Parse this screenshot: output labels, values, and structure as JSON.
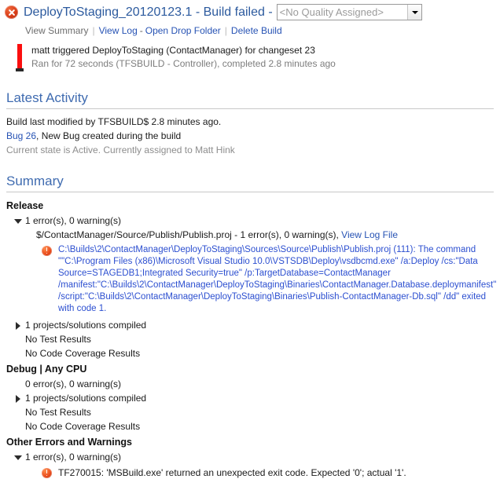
{
  "header": {
    "status_icon": "build-failed-icon",
    "title": "DeployToStaging_20120123.1 - Build failed -",
    "quality": {
      "value": "<No Quality Assigned>",
      "arrow_icon": "chevron-down-icon"
    }
  },
  "commands": {
    "view_summary": "View Summary",
    "view_log": "View Log",
    "open_drop_folder": "Open Drop Folder",
    "delete_build": "Delete Build",
    "dash": "-"
  },
  "trigger": {
    "line1": "matt triggered DeployToStaging (ContactManager) for changeset 23",
    "line2": "Ran for 72 seconds (TFSBUILD - Controller), completed 2.8 minutes ago"
  },
  "latest_activity": {
    "heading": "Latest Activity",
    "modified": "Build last modified by TFSBUILD$ 2.8 minutes ago.",
    "bug_link": "Bug 26",
    "bug_rest": ", New Bug created during the build",
    "bug_state": "Current state is Active. Currently assigned to Matt Hink"
  },
  "summary": {
    "heading": "Summary",
    "configs": [
      {
        "name": "Release",
        "counts": "1 error(s), 0 warning(s)",
        "counts_expanded": true,
        "file_line_prefix": "$/ContactManager/Source/Publish/Publish.proj - 1 error(s), 0 warning(s), ",
        "file_link": "View Log File",
        "error": "C:\\Builds\\2\\ContactManager\\DeployToStaging\\Sources\\Source\\Publish\\Publish.proj (111): The command \"\"C:\\Program Files (x86)\\Microsoft Visual Studio 10.0\\VSTSDB\\Deploy\\vsdbcmd.exe\" /a:Deploy /cs:\"Data Source=STAGEDB1;Integrated Security=true\" /p:TargetDatabase=ContactManager /manifest:\"C:\\Builds\\2\\ContactManager\\DeployToStaging\\Binaries\\ContactManager.Database.deploymanifest\" /script:\"C:\\Builds\\2\\ContactManager\\DeployToStaging\\Binaries\\Publish-ContactManager-Db.sql\" /dd\" exited with code 1.",
        "compiled": "1 projects/solutions compiled",
        "tests": "No Test Results",
        "coverage": "No Code Coverage Results"
      },
      {
        "name": "Debug | Any CPU",
        "counts": "0 error(s), 0 warning(s)",
        "counts_expanded": false,
        "compiled": "1 projects/solutions compiled",
        "tests": "No Test Results",
        "coverage": "No Code Coverage Results"
      }
    ],
    "other": {
      "name": "Other Errors and Warnings",
      "counts": "1 error(s), 0 warning(s)",
      "error": "TF270015: 'MSBuild.exe' returned an unexpected exit code. Expected '0'; actual '1'."
    }
  },
  "colors": {
    "link": "#2753b4",
    "heading": "#3f6bb0",
    "error_text": "#2c4fd0",
    "muted": "#8d8d8d",
    "fail_red": "#d83b16"
  }
}
